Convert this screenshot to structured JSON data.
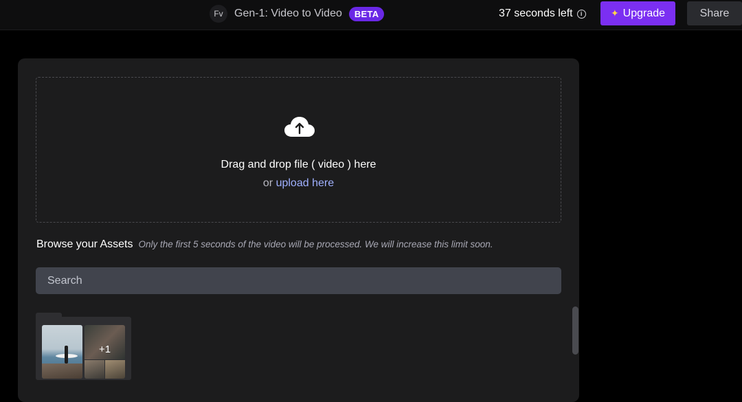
{
  "header": {
    "avatar_initials": "Fv",
    "project_title": "Gen-1: Video to Video",
    "badge": "BETA",
    "timer": "37 seconds left",
    "info_icon": "info-circle-icon",
    "upgrade_label": "Upgrade",
    "upgrade_icon": "sparkle-icon",
    "share_label": "Share"
  },
  "upload": {
    "icon": "cloud-upload-icon",
    "instruction": "Drag and drop file ( video ) here",
    "or_text": "or",
    "link_text": "upload here"
  },
  "assets": {
    "title": "Browse your Assets",
    "note": "Only the first 5 seconds of the video will be processed. We will increase this limit soon.",
    "search_placeholder": "Search",
    "folder_extra_count": "+1"
  },
  "colors": {
    "accent": "#7b2ff2",
    "badge": "#6a28e6",
    "link": "#9fb0ff",
    "panel": "#1c1c1d"
  }
}
